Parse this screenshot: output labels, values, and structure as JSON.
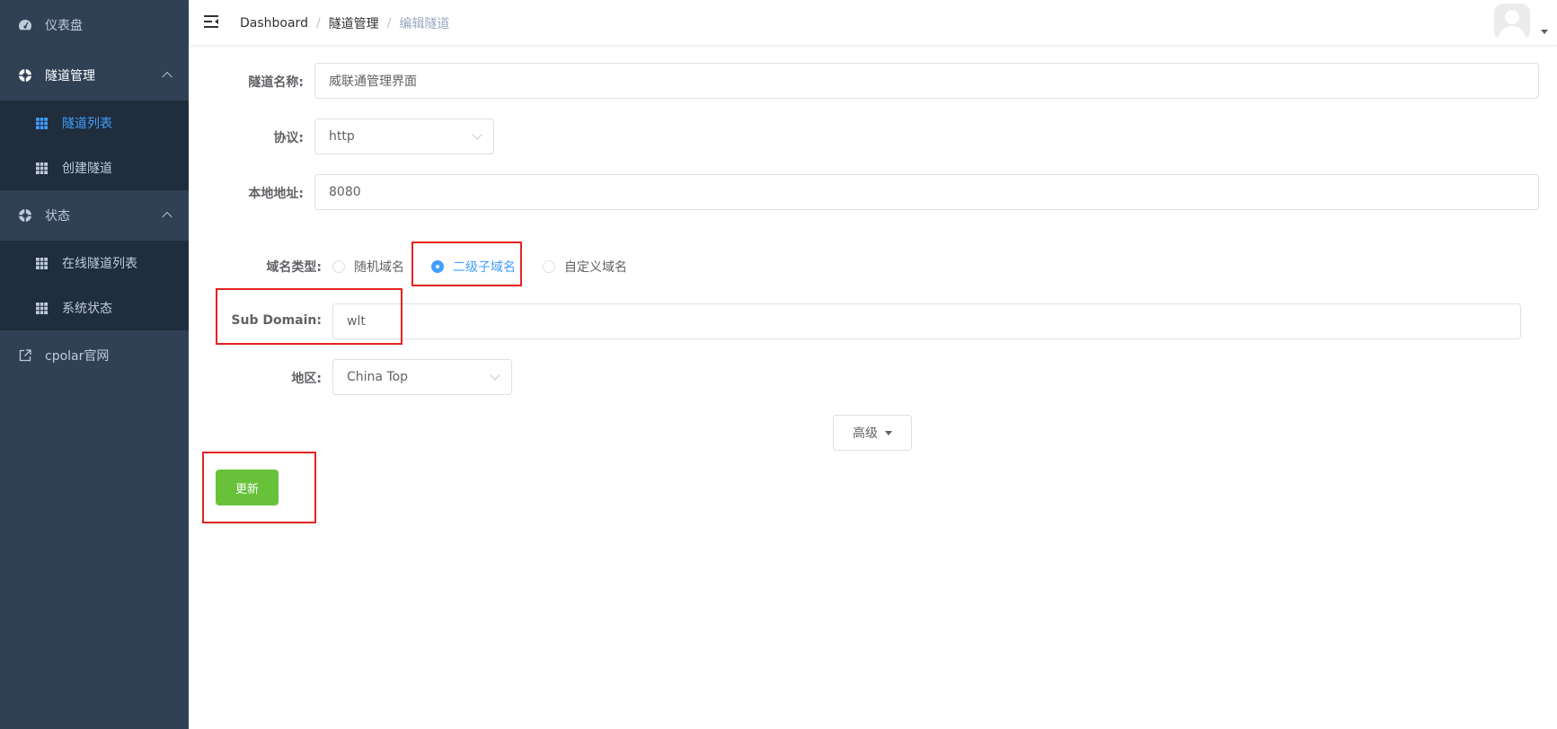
{
  "sidebar": {
    "dashboard": "仪表盘",
    "tunnel_mgmt": "隧道管理",
    "tunnel_list": "隧道列表",
    "create_tunnel": "创建隧道",
    "status": "状态",
    "online_tunnels": "在线隧道列表",
    "system_status": "系统状态",
    "cpolar_site": "cpolar官网"
  },
  "header": {
    "breadcrumb": [
      "Dashboard",
      "隧道管理",
      "编辑隧道"
    ],
    "separator": "/"
  },
  "form": {
    "tunnel_name_label": "隧道名称:",
    "tunnel_name_value": "威联通管理界面",
    "protocol_label": "协议:",
    "protocol_value": "http",
    "local_addr_label": "本地地址:",
    "local_addr_value": "8080",
    "domain_type_label": "域名类型:",
    "domain_types": [
      "随机域名",
      "二级子域名",
      "自定义域名"
    ],
    "domain_type_selected": "二级子域名",
    "sub_domain_label": "Sub Domain:",
    "sub_domain_value": "wlt",
    "region_label": "地区:",
    "region_value": "China Top",
    "advanced_label": "高级",
    "update_label": "更新"
  },
  "colors": {
    "sidebar_bg": "#304156",
    "submenu_bg": "#1f2d3d",
    "active": "#409eff",
    "success": "#67c23a",
    "highlight": "#e5231f"
  }
}
